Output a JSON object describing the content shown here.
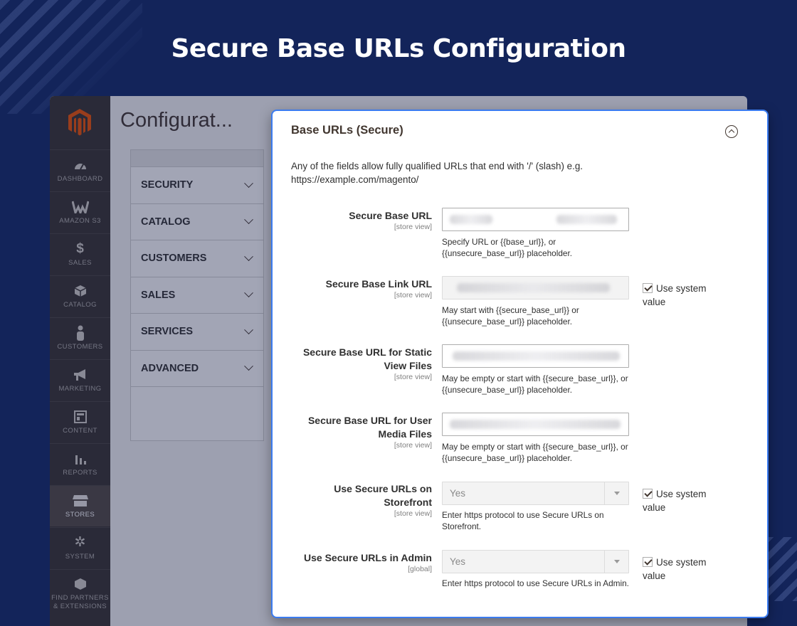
{
  "headline": "Secure Base URLs Configuration",
  "admin": {
    "page_title": "Configurat...",
    "sidebar": [
      {
        "label": "DASHBOARD",
        "icon": "dashboard-icon",
        "glyph": "◔"
      },
      {
        "label": "AMAZON S3",
        "icon": "amazon-s3-icon",
        "glyph": "W"
      },
      {
        "label": "SALES",
        "icon": "dollar-icon",
        "glyph": "$"
      },
      {
        "label": "CATALOG",
        "icon": "box-icon",
        "glyph": "◈"
      },
      {
        "label": "CUSTOMERS",
        "icon": "person-icon",
        "glyph": "♟"
      },
      {
        "label": "MARKETING",
        "icon": "megaphone-icon",
        "glyph": "📢"
      },
      {
        "label": "CONTENT",
        "icon": "layout-icon",
        "glyph": "▦"
      },
      {
        "label": "REPORTS",
        "icon": "bar-chart-icon",
        "glyph": "▮"
      },
      {
        "label": "STORES",
        "icon": "storefront-icon",
        "glyph": "⌂"
      },
      {
        "label": "SYSTEM",
        "icon": "gear-icon",
        "glyph": "✲"
      },
      {
        "label": "FIND PARTNERS & EXTENSIONS",
        "icon": "cube-icon",
        "glyph": "❒"
      }
    ],
    "tabs": [
      "SECURITY",
      "CATALOG",
      "CUSTOMERS",
      "SALES",
      "SERVICES",
      "ADVANCED"
    ]
  },
  "panel": {
    "title": "Base URLs (Secure)",
    "intro": "Any of the fields allow fully qualified URLs that end with '/' (slash) e.g. https://example.com/magento/",
    "fields": [
      {
        "label": "Secure Base URL",
        "scope": "[store view]",
        "note": "Specify URL or {{base_url}}, or {{unsecure_base_url}} placeholder."
      },
      {
        "label": "Secure Base Link URL",
        "scope": "[store view]",
        "note": "May start with {{secure_base_url}} or {{unsecure_base_url}} placeholder.",
        "system": "Use system value"
      },
      {
        "label": "Secure Base URL for Static View Files",
        "scope": "[store view]",
        "note": "May be empty or start with {{secure_base_url}}, or {{unsecure_base_url}} placeholder."
      },
      {
        "label": "Secure Base URL for User Media Files",
        "scope": "[store view]",
        "note": "May be empty or start with {{secure_base_url}}, or {{unsecure_base_url}} placeholder."
      },
      {
        "label": "Use Secure URLs on Storefront",
        "scope": "[store view]",
        "value": "Yes",
        "note": "Enter https protocol to use Secure URLs on Storefront.",
        "system": "Use system value"
      },
      {
        "label": "Use Secure URLs in Admin",
        "scope": "[global]",
        "value": "Yes",
        "note": "Enter https protocol to use Secure URLs in Admin.",
        "system": "Use system value"
      }
    ]
  },
  "colors": {
    "background": "#13245a",
    "panel_border": "#3b7cf0",
    "sidebar": "#373330",
    "magento_orange": "#eb5202"
  }
}
